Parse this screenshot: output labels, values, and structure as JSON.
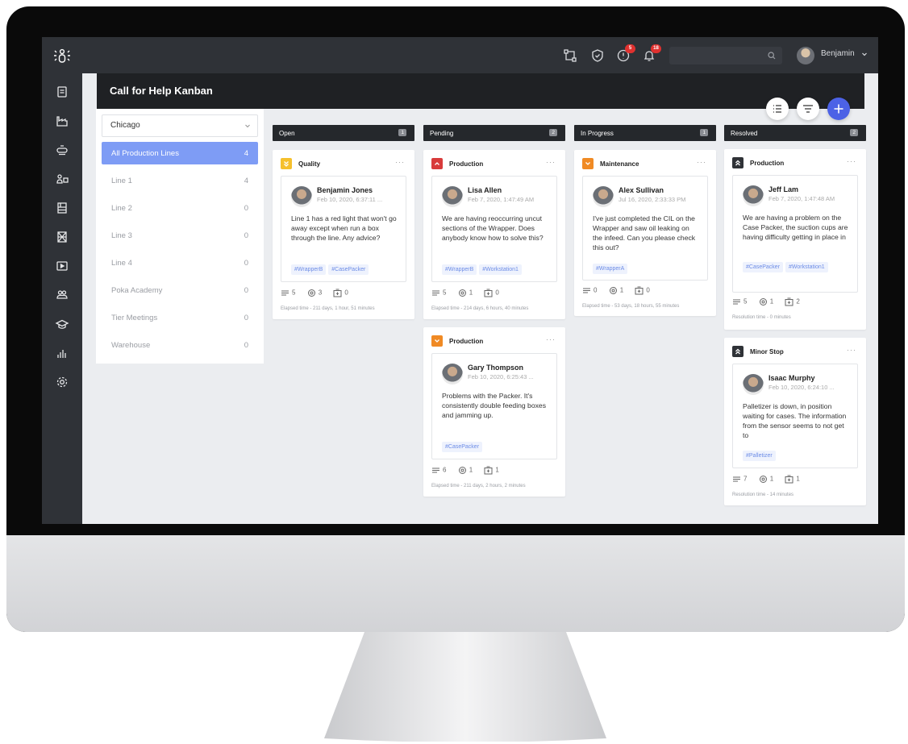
{
  "app": {
    "username": "Benjamin",
    "notifications": {
      "alerts_badge": "5",
      "bell_badge": "18"
    },
    "search_placeholder": ""
  },
  "page": {
    "title": "Call for Help Kanban"
  },
  "filter": {
    "plant": "Chicago"
  },
  "lines": [
    {
      "name": "All Production Lines",
      "count": "4"
    },
    {
      "name": "Line 1",
      "count": "4"
    },
    {
      "name": "Line 2",
      "count": "0"
    },
    {
      "name": "Line 3",
      "count": "0"
    },
    {
      "name": "Line 4",
      "count": "0"
    },
    {
      "name": "Poka Academy",
      "count": "0"
    },
    {
      "name": "Tier Meetings",
      "count": "0"
    },
    {
      "name": "Warehouse",
      "count": "0"
    }
  ],
  "columns": [
    {
      "title": "Open",
      "count": "1"
    },
    {
      "title": "Pending",
      "count": "2"
    },
    {
      "title": "In Progress",
      "count": "1"
    },
    {
      "title": "Resolved",
      "count": "2"
    }
  ],
  "cards": [
    {
      "category": "Quality",
      "author": "Benjamin Jones",
      "date": "Feb 10, 2020, 6:37:11 ...",
      "message": "Line 1 has a red light that won't go away except when run a box through the line. Any advice?",
      "tags": [
        "#WrapperB",
        "#CasePacker"
      ],
      "comments": "5",
      "watchers": "3",
      "attachments": "0",
      "time": "Elapsed time - 211 days, 1 hour, 51 minutes"
    },
    {
      "category": "Production",
      "author": "Lisa Allen",
      "date": "Feb 7, 2020, 1:47:49 AM",
      "message": "We are having reoccurring uncut sections of the Wrapper. Does anybody know how to solve this?",
      "tags": [
        "#WrapperB",
        "#Workstation1"
      ],
      "comments": "5",
      "watchers": "1",
      "attachments": "0",
      "time": "Elapsed time - 214 days, 6 hours, 40 minutes"
    },
    {
      "category": "Production",
      "author": "Gary Thompson",
      "date": "Feb 10, 2020, 6:25:43 ...",
      "message": "Problems with the Packer. It's consistently double feeding boxes and jamming up.",
      "tags": [
        "#CasePacker"
      ],
      "comments": "6",
      "watchers": "1",
      "attachments": "1",
      "time": "Elapsed time - 211 days, 2 hours, 2 minutes"
    },
    {
      "category": "Maintenance",
      "author": "Alex Sullivan",
      "date": "Jul 16, 2020, 2:33:33 PM",
      "message": "I've just completed the CIL on the Wrapper and saw oil leaking on the infeed. Can you please check this out?",
      "tags": [
        "#WrapperA"
      ],
      "comments": "0",
      "watchers": "1",
      "attachments": "0",
      "time": "Elapsed time - 53 days, 18 hours, 55 minutes"
    },
    {
      "category": "Production",
      "author": "Jeff Lam",
      "date": "Feb 7, 2020, 1:47:48 AM",
      "message": "We are having a problem on the Case Packer, the suction cups are having difficulty getting in place in",
      "tags": [
        "#CasePacker",
        "#Workstation1"
      ],
      "comments": "5",
      "watchers": "1",
      "attachments": "2",
      "time": "Resolution time - 0 minutes"
    },
    {
      "category": "Minor Stop",
      "author": "Isaac Murphy",
      "date": "Feb 10, 2020, 6:24:10 ...",
      "message": "Palletizer is down, in position waiting for cases. The information from the sensor seems to not get to",
      "tags": [
        "#Palletizer"
      ],
      "comments": "7",
      "watchers": "1",
      "attachments": "1",
      "time": "Resolution time - 14 minutes"
    }
  ],
  "colors": {
    "accent": "#4c62e6",
    "active_line": "#7e9cf5",
    "prio_yellow": "#f5c02c",
    "prio_red": "#d83b3b",
    "prio_orange": "#f08a24",
    "prio_dark": "#2f3237"
  },
  "icons": [
    "logo-icon",
    "workflow-icon",
    "shield-icon",
    "alert-icon",
    "bell-icon",
    "search-icon",
    "chevron-down-icon",
    "list-view-icon",
    "filter-icon",
    "add-icon",
    "comments-icon",
    "watchers-icon",
    "attachments-icon"
  ]
}
